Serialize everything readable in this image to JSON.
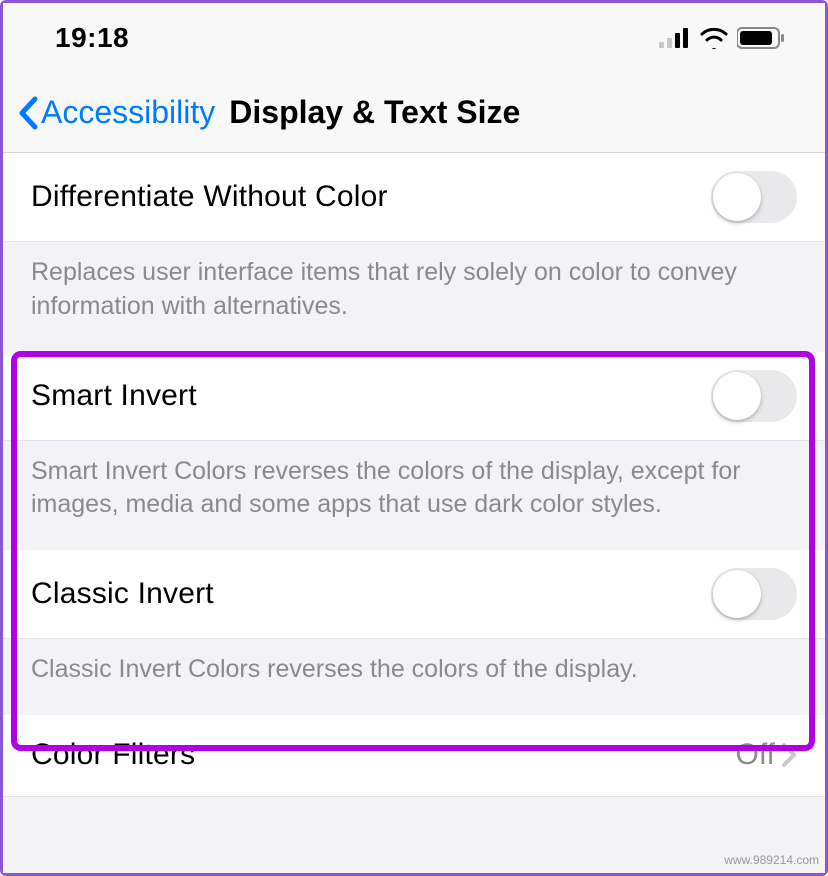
{
  "status": {
    "time": "19:18"
  },
  "nav": {
    "back_label": "Accessibility",
    "title": "Display & Text Size"
  },
  "sections": {
    "differentiate": {
      "label": "Differentiate Without Color",
      "note": "Replaces user interface items that rely solely on color to convey information with alternatives.",
      "toggle_on": false
    },
    "smart_invert": {
      "label": "Smart Invert",
      "note": "Smart Invert Colors reverses the colors of the display, except for images, media and some apps that use dark color styles.",
      "toggle_on": false
    },
    "classic_invert": {
      "label": "Classic Invert",
      "note": "Classic Invert Colors reverses the colors of the display.",
      "toggle_on": false
    },
    "color_filters": {
      "label": "Color Filters",
      "value": "Off"
    }
  },
  "watermark": "www.989214.com"
}
